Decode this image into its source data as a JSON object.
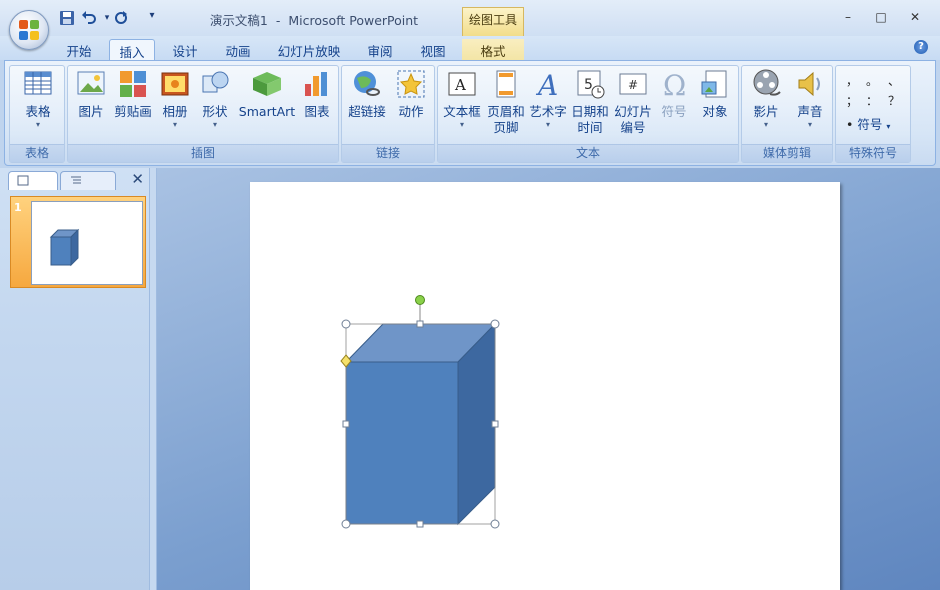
{
  "title_bar": {
    "document_name": "演示文稿1",
    "separator": "-",
    "app_name": "Microsoft PowerPoint",
    "context_tool_group": "绘图工具",
    "qat": {
      "save_icon": "save-icon",
      "undo_icon": "undo-icon",
      "redo_icon": "redo-icon",
      "customize_icon": "customize-qat-icon"
    },
    "window_buttons": {
      "minimize": "–",
      "maximize": "□",
      "close": "✕"
    }
  },
  "tabs": [
    "开始",
    "插入",
    "设计",
    "动画",
    "幻灯片放映",
    "审阅",
    "视图",
    "格式"
  ],
  "active_tab": "插入",
  "help": "?",
  "ribbon": {
    "groups": {
      "tables": "表格",
      "illustrations": "插图",
      "links": "链接",
      "text": "文本",
      "media": "媒体剪辑",
      "symbols": "特殊符号"
    },
    "buttons": {
      "table": "表格",
      "picture": "图片",
      "clipart": "剪贴画",
      "album": "相册",
      "shapes": "形状",
      "smartart": "SmartArt",
      "chart": "图表",
      "hyperlink": "超链接",
      "action": "动作",
      "textbox": "文本框",
      "header_footer_1": "页眉和",
      "header_footer_2": "页脚",
      "wordart": "艺术字",
      "datetime_1": "日期和",
      "datetime_2": "时间",
      "slide_number_1": "幻灯片",
      "slide_number_2": "编号",
      "symbol": "符号",
      "object": "对象",
      "movie": "影片",
      "sound": "声音",
      "special_symbol": "符号"
    },
    "special_symbol_glyphs": [
      "，",
      "。",
      "、",
      "；",
      "：",
      "？"
    ],
    "bullet": "•",
    "dropdown_arrow": "▾"
  },
  "slides_panel": {
    "close": "✕",
    "slides": [
      {
        "number": "1"
      }
    ]
  },
  "colors": {
    "cube_front": "#4f81bd",
    "cube_top": "#6f95c8",
    "cube_side": "#3d68a0",
    "cube_edge": "#385d8a",
    "handle_rotate": "#8ad14a",
    "handle_adjust": "#f5e16b"
  }
}
